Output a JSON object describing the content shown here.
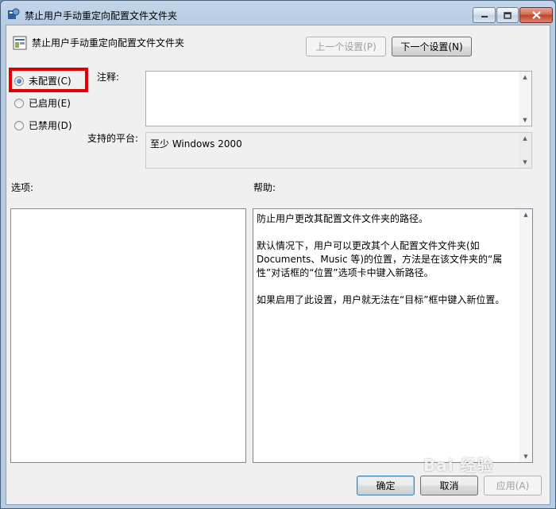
{
  "window": {
    "title": "禁止用户手动重定向配置文件文件夹"
  },
  "header": {
    "title": "禁止用户手动重定向配置文件文件夹",
    "prev_label": "上一个设置(P)",
    "next_label": "下一个设置(N)"
  },
  "state": {
    "options": [
      {
        "label": "未配置(C)",
        "checked": true
      },
      {
        "label": "已启用(E)",
        "checked": false
      },
      {
        "label": "已禁用(D)",
        "checked": false
      }
    ]
  },
  "comment": {
    "label": "注释:",
    "value": ""
  },
  "platform": {
    "label": "支持的平台:",
    "value": "至少 Windows 2000"
  },
  "options_panel": {
    "label": "选项:"
  },
  "help": {
    "label": "帮助:",
    "paragraphs": [
      "防止用户更改其配置文件文件夹的路径。",
      "默认情况下，用户可以更改其个人配置文件文件夹(如 Documents、Music 等)的位置，方法是在该文件夹的“属性”对话框的“位置”选项卡中键入新路径。",
      "如果启用了此设置，用户就无法在“目标”框中键入新位置。"
    ]
  },
  "footer": {
    "ok": "确定",
    "cancel": "取消",
    "apply": "应用(A)"
  },
  "watermark": "Bai 经验",
  "icons": {
    "title": "policy-setting-icon",
    "header": "policy-setting-icon",
    "minimize": "minimize-icon",
    "maximize": "maximize-icon",
    "close": "close-icon"
  },
  "colors": {
    "highlight_box": "#e10000",
    "close_button": "#c0402b"
  }
}
